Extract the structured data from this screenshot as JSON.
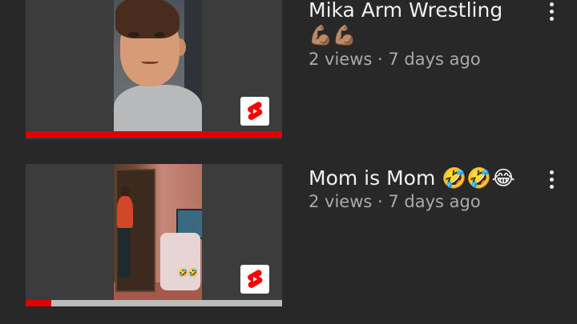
{
  "videos": [
    {
      "title": "Mika Arm Wrestling",
      "title_emoji": "💪🏽💪🏽",
      "meta": "2 views · 7 days ago",
      "watched_fraction": 1.0,
      "thumbnail": "animated boy character",
      "badge_icon": "shorts-icon",
      "menu_icon": "more-vert-icon"
    },
    {
      "title": "Mom is Mom 🤣🤣😂",
      "meta": "2 views · 7 days ago",
      "watched_fraction": 0.1,
      "thumbnail": "woman in room photo",
      "thumb_overlay_emoji": "🤣🤣",
      "badge_icon": "shorts-icon",
      "menu_icon": "more-vert-icon"
    }
  ],
  "colors": {
    "background": "#282828",
    "progress": "#e00000",
    "shorts_red": "#ff0000",
    "title_text": "#f1f1f1",
    "meta_text": "#aaaaaa"
  }
}
